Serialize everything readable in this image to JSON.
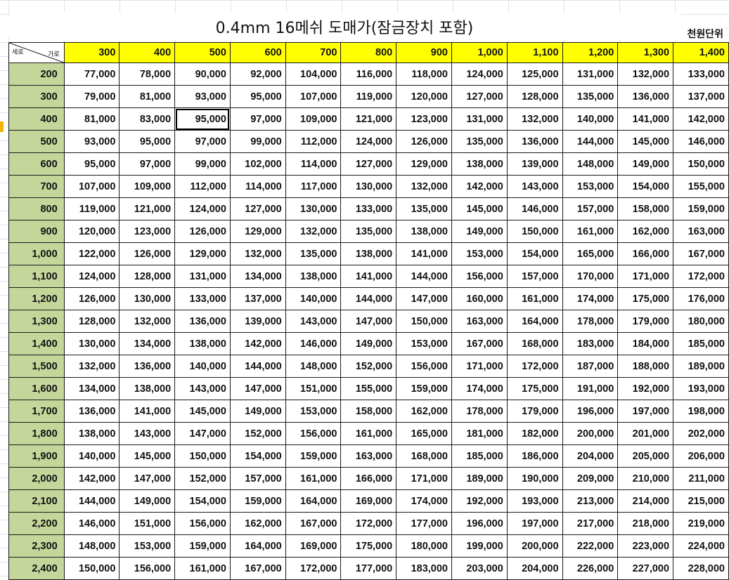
{
  "title": "0.4mm 16메쉬 도매가(잠금장치 포함)",
  "unit_label": "천원단위",
  "corner": {
    "vertical": "세로",
    "horizontal": "가로"
  },
  "columns": [
    "300",
    "400",
    "500",
    "600",
    "700",
    "800",
    "900",
    "1,000",
    "1,100",
    "1,200",
    "1,300",
    "1,400"
  ],
  "selected_cell": {
    "row": "400",
    "column": "500"
  },
  "rows": [
    {
      "h": "200",
      "v": [
        "77,000",
        "78,000",
        "90,000",
        "92,000",
        "104,000",
        "116,000",
        "118,000",
        "124,000",
        "125,000",
        "131,000",
        "132,000",
        "133,000"
      ]
    },
    {
      "h": "300",
      "v": [
        "79,000",
        "81,000",
        "93,000",
        "95,000",
        "107,000",
        "119,000",
        "120,000",
        "127,000",
        "128,000",
        "135,000",
        "136,000",
        "137,000"
      ]
    },
    {
      "h": "400",
      "v": [
        "81,000",
        "83,000",
        "95,000",
        "97,000",
        "109,000",
        "121,000",
        "123,000",
        "131,000",
        "132,000",
        "140,000",
        "141,000",
        "142,000"
      ]
    },
    {
      "h": "500",
      "v": [
        "93,000",
        "95,000",
        "97,000",
        "99,000",
        "112,000",
        "124,000",
        "126,000",
        "135,000",
        "136,000",
        "144,000",
        "145,000",
        "146,000"
      ]
    },
    {
      "h": "600",
      "v": [
        "95,000",
        "97,000",
        "99,000",
        "102,000",
        "114,000",
        "127,000",
        "129,000",
        "138,000",
        "139,000",
        "148,000",
        "149,000",
        "150,000"
      ]
    },
    {
      "h": "700",
      "v": [
        "107,000",
        "109,000",
        "112,000",
        "114,000",
        "117,000",
        "130,000",
        "132,000",
        "142,000",
        "143,000",
        "153,000",
        "154,000",
        "155,000"
      ]
    },
    {
      "h": "800",
      "v": [
        "119,000",
        "121,000",
        "124,000",
        "127,000",
        "130,000",
        "133,000",
        "135,000",
        "145,000",
        "146,000",
        "157,000",
        "158,000",
        "159,000"
      ]
    },
    {
      "h": "900",
      "v": [
        "120,000",
        "123,000",
        "126,000",
        "129,000",
        "132,000",
        "135,000",
        "138,000",
        "149,000",
        "150,000",
        "161,000",
        "162,000",
        "163,000"
      ]
    },
    {
      "h": "1,000",
      "v": [
        "122,000",
        "126,000",
        "129,000",
        "132,000",
        "135,000",
        "138,000",
        "141,000",
        "153,000",
        "154,000",
        "165,000",
        "166,000",
        "167,000"
      ]
    },
    {
      "h": "1,100",
      "v": [
        "124,000",
        "128,000",
        "131,000",
        "134,000",
        "138,000",
        "141,000",
        "144,000",
        "156,000",
        "157,000",
        "170,000",
        "171,000",
        "172,000"
      ]
    },
    {
      "h": "1,200",
      "v": [
        "126,000",
        "130,000",
        "133,000",
        "137,000",
        "140,000",
        "144,000",
        "147,000",
        "160,000",
        "161,000",
        "174,000",
        "175,000",
        "176,000"
      ]
    },
    {
      "h": "1,300",
      "v": [
        "128,000",
        "132,000",
        "136,000",
        "139,000",
        "143,000",
        "147,000",
        "150,000",
        "163,000",
        "164,000",
        "178,000",
        "179,000",
        "180,000"
      ]
    },
    {
      "h": "1,400",
      "v": [
        "130,000",
        "134,000",
        "138,000",
        "142,000",
        "146,000",
        "149,000",
        "153,000",
        "167,000",
        "168,000",
        "183,000",
        "184,000",
        "185,000"
      ]
    },
    {
      "h": "1,500",
      "v": [
        "132,000",
        "136,000",
        "140,000",
        "144,000",
        "148,000",
        "152,000",
        "156,000",
        "171,000",
        "172,000",
        "187,000",
        "188,000",
        "189,000"
      ]
    },
    {
      "h": "1,600",
      "v": [
        "134,000",
        "138,000",
        "143,000",
        "147,000",
        "151,000",
        "155,000",
        "159,000",
        "174,000",
        "175,000",
        "191,000",
        "192,000",
        "193,000"
      ]
    },
    {
      "h": "1,700",
      "v": [
        "136,000",
        "141,000",
        "145,000",
        "149,000",
        "153,000",
        "158,000",
        "162,000",
        "178,000",
        "179,000",
        "196,000",
        "197,000",
        "198,000"
      ]
    },
    {
      "h": "1,800",
      "v": [
        "138,000",
        "143,000",
        "147,000",
        "152,000",
        "156,000",
        "161,000",
        "165,000",
        "181,000",
        "182,000",
        "200,000",
        "201,000",
        "202,000"
      ]
    },
    {
      "h": "1,900",
      "v": [
        "140,000",
        "145,000",
        "150,000",
        "154,000",
        "159,000",
        "163,000",
        "168,000",
        "185,000",
        "186,000",
        "204,000",
        "205,000",
        "206,000"
      ]
    },
    {
      "h": "2,000",
      "v": [
        "142,000",
        "147,000",
        "152,000",
        "157,000",
        "161,000",
        "166,000",
        "171,000",
        "189,000",
        "190,000",
        "209,000",
        "210,000",
        "211,000"
      ]
    },
    {
      "h": "2,100",
      "v": [
        "144,000",
        "149,000",
        "154,000",
        "159,000",
        "164,000",
        "169,000",
        "174,000",
        "192,000",
        "193,000",
        "213,000",
        "214,000",
        "215,000"
      ]
    },
    {
      "h": "2,200",
      "v": [
        "146,000",
        "151,000",
        "156,000",
        "162,000",
        "167,000",
        "172,000",
        "177,000",
        "196,000",
        "197,000",
        "217,000",
        "218,000",
        "219,000"
      ]
    },
    {
      "h": "2,300",
      "v": [
        "148,000",
        "153,000",
        "159,000",
        "164,000",
        "169,000",
        "175,000",
        "180,000",
        "199,000",
        "200,000",
        "222,000",
        "223,000",
        "224,000"
      ]
    },
    {
      "h": "2,400",
      "v": [
        "150,000",
        "156,000",
        "161,000",
        "167,000",
        "172,000",
        "177,000",
        "183,000",
        "203,000",
        "204,000",
        "226,000",
        "227,000",
        "228,000"
      ]
    }
  ]
}
